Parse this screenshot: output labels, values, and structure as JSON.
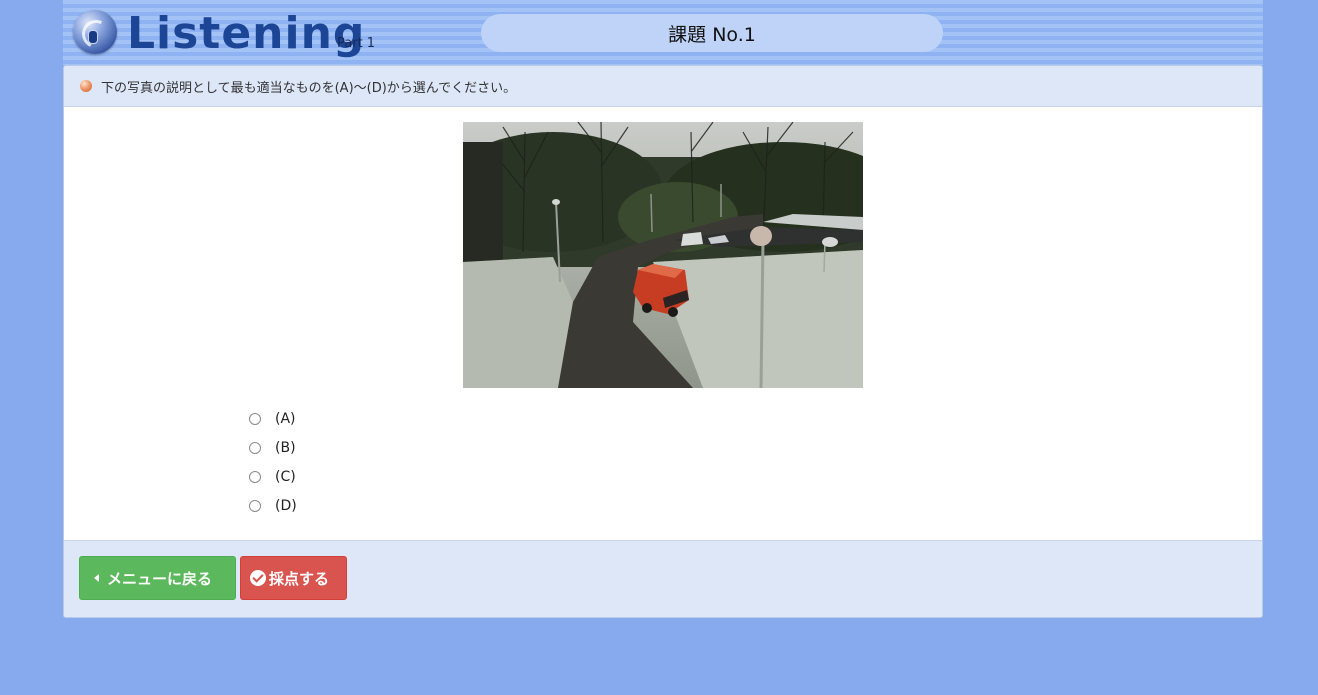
{
  "header": {
    "title": "Listening",
    "part": "Part 1",
    "task": "課題 No.1"
  },
  "instruction": "下の写真の説明として最も適当なものを(A)〜(D)から選んでください。",
  "photo": {
    "icon": "photo-snowy-road-red-van"
  },
  "choices": [
    {
      "label": "(A)"
    },
    {
      "label": "(B)"
    },
    {
      "label": "(C)"
    },
    {
      "label": "(D)"
    }
  ],
  "buttons": {
    "back": "メニューに戻る",
    "score": "採点する"
  },
  "colors": {
    "background": "#87aaee",
    "header_title": "#1c4595",
    "back_button": "#5cb85c",
    "score_button": "#d9534f",
    "panel_band": "#dde7f8"
  }
}
